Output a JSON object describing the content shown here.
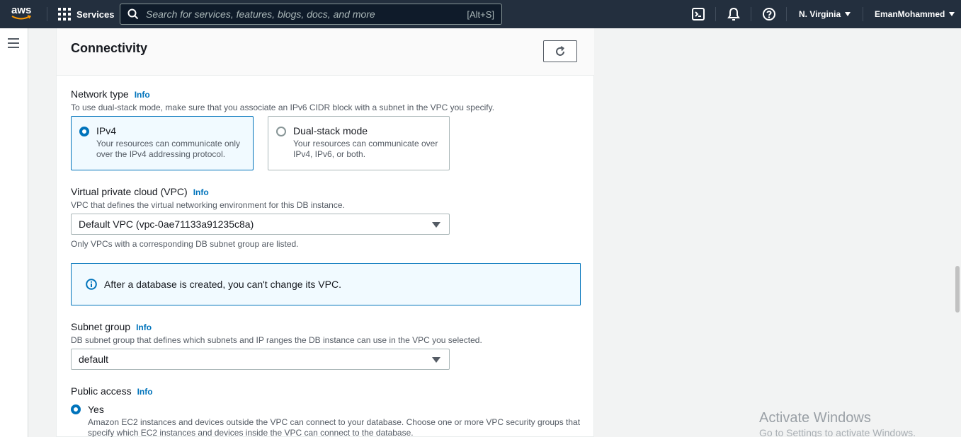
{
  "topnav": {
    "logo_text": "aws",
    "services_label": "Services",
    "search_placeholder": "Search for services, features, blogs, docs, and more",
    "search_shortcut": "[Alt+S]",
    "region": "N. Virginia",
    "user": "EmanMohammed",
    "icons": [
      "cloudshell-icon",
      "bell-icon",
      "help-icon"
    ]
  },
  "page": {
    "title": "Connectivity"
  },
  "network_type": {
    "label": "Network type",
    "info": "Info",
    "description": "To use dual-stack mode, make sure that you associate an IPv6 CIDR block with a subnet in the VPC you specify.",
    "options": [
      {
        "title": "IPv4",
        "description": "Your resources can communicate only over the IPv4 addressing protocol.",
        "selected": true
      },
      {
        "title": "Dual-stack mode",
        "description": "Your resources can communicate over IPv4, IPv6, or both.",
        "selected": false
      }
    ]
  },
  "vpc": {
    "label": "Virtual private cloud (VPC)",
    "info": "Info",
    "description": "VPC that defines the virtual networking environment for this DB instance.",
    "value": "Default VPC (vpc-0ae71133a91235c8a)",
    "hint": "Only VPCs with a corresponding DB subnet group are listed."
  },
  "alert": {
    "text": "After a database is created, you can't change its VPC."
  },
  "subnet_group": {
    "label": "Subnet group",
    "info": "Info",
    "description": "DB subnet group that defines which subnets and IP ranges the DB instance can use in the VPC you selected.",
    "value": "default"
  },
  "public_access": {
    "label": "Public access",
    "info": "Info",
    "yes_label": "Yes",
    "yes_description_line1": "Amazon EC2 instances and devices outside the VPC can connect to your database. Choose one or more VPC security groups that",
    "yes_description_line2": "specify which EC2 instances and devices inside the VPC can connect to the database."
  },
  "watermark": {
    "line1": "Activate Windows",
    "line2": "Go to Settings to activate Windows."
  },
  "colors": {
    "nav_bg": "#232f3e",
    "accent": "#0073bb",
    "alert_bg": "#f1faff"
  }
}
